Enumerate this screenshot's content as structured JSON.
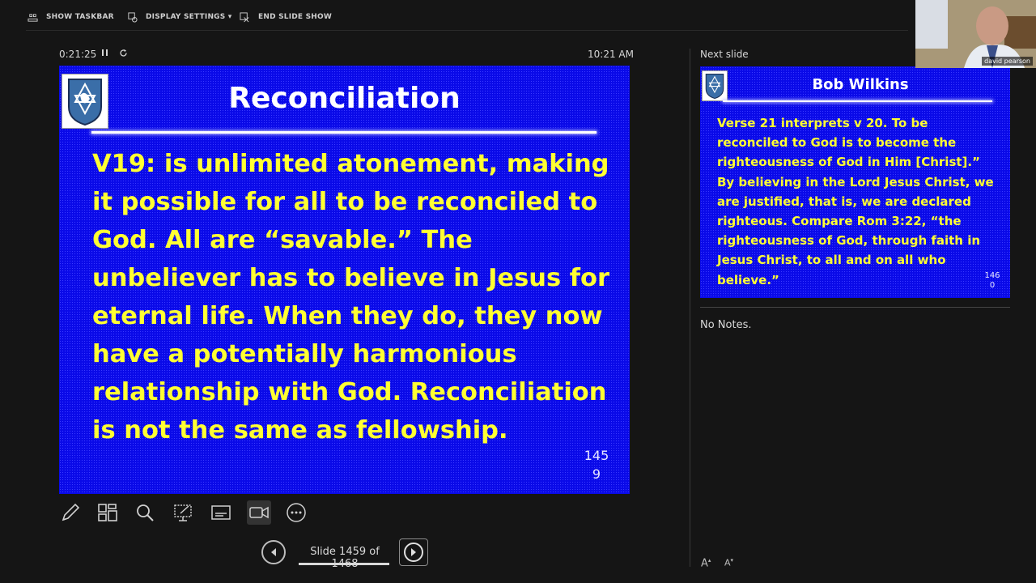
{
  "toolbar": {
    "show_taskbar": "SHOW TASKBAR",
    "display_settings": "DISPLAY SETTINGS ▾",
    "end_slide_show": "END SLIDE SHOW"
  },
  "status": {
    "elapsed": "0:21:25",
    "pause_icon": "pause-icon",
    "restart_icon": "restart-icon",
    "clock": "10:21 AM"
  },
  "current_slide": {
    "title": "Reconciliation",
    "body": "V19: is unlimited atonement, making it possible for all to be reconciled to God. All are “savable.” The unbeliever has to believe in Jesus for eternal life. When they do, they now have a potentially harmonious relationship with God. Reconciliation is not the same as fellowship.",
    "number_line1": "145",
    "number_line2": "9",
    "colors": {
      "background": "#0a0ae8",
      "title": "#ffffff",
      "body": "#ffff33"
    }
  },
  "tools": [
    {
      "name": "pen-icon"
    },
    {
      "name": "see-all-slides-icon"
    },
    {
      "name": "zoom-icon"
    },
    {
      "name": "pointer-options-icon"
    },
    {
      "name": "subtitles-icon"
    },
    {
      "name": "camera-icon"
    },
    {
      "name": "more-options-icon"
    }
  ],
  "navigation": {
    "slide_counter": "Slide 1459 of 1468"
  },
  "next_slide_panel": {
    "label": "Next slide",
    "title": "Bob Wilkins",
    "body": "Verse 21 interprets v 20. To be reconciled to God is to become the righteousness of God in Him [Christ].” By believing in the Lord Jesus Christ, we are justified, that is, we are declared righteous. Compare Rom 3:22, “the righteousness of God, through faith in Jesus Christ, to all and on all who believe.”",
    "number_line1": "146",
    "number_line2": "0"
  },
  "notes": {
    "text": "No Notes.",
    "increase_font": "A",
    "decrease_font": "A"
  },
  "webcam": {
    "name": "david pearson"
  }
}
